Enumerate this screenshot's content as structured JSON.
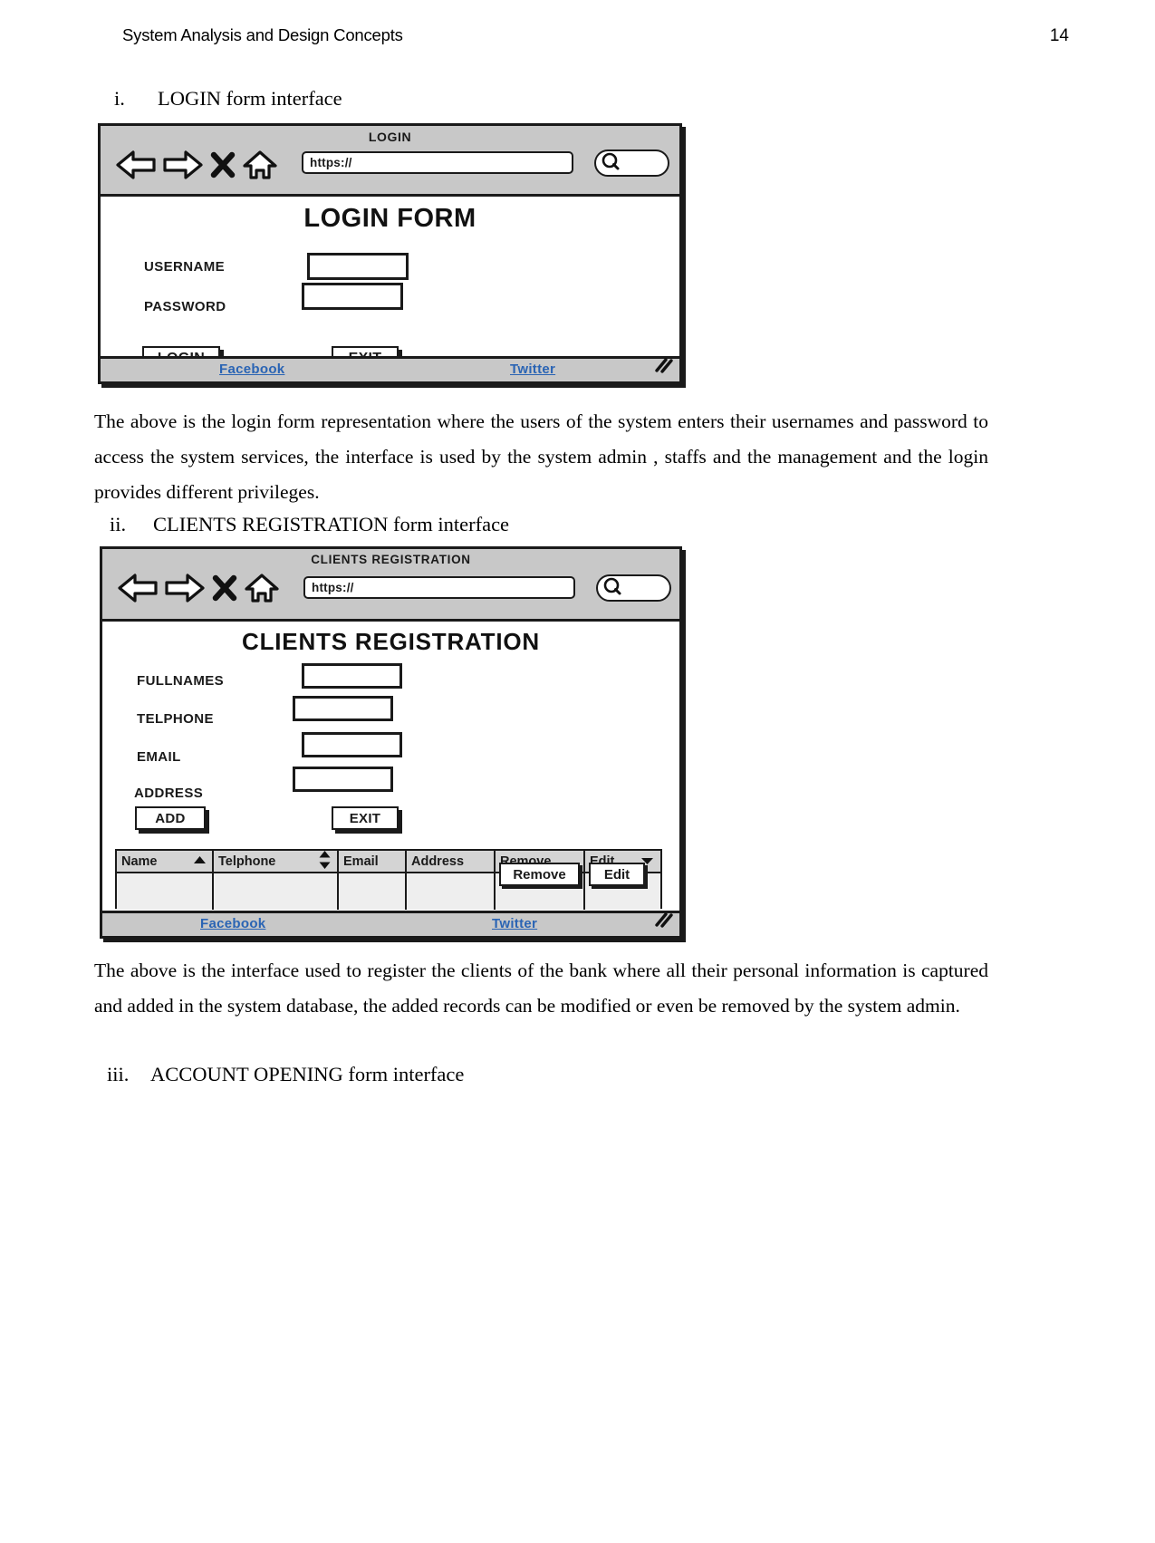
{
  "document": {
    "header_title": "System Analysis and Design Concepts",
    "page_number": "14"
  },
  "items": [
    {
      "marker": "i.",
      "text": "LOGIN form interface"
    },
    {
      "marker": "ii.",
      "text": "CLIENTS REGISTRATION form interface"
    },
    {
      "marker": "iii.",
      "text": "ACCOUNT OPENING form interface"
    }
  ],
  "paragraphs": {
    "login": "The above is the login form representation where the users of the system enters their usernames and password to access the system services, the interface is used by the system admin , staffs and the management and the login provides different privileges.",
    "clients": "The above is the interface used to register the clients of the bank where all their personal information is captured and added in the system database, the added records can be modified or even be removed by the system admin."
  },
  "login_mockup": {
    "browser": {
      "title": "LOGIN",
      "url_value": "https://",
      "back_icon": "back-arrow-icon",
      "forward_icon": "forward-arrow-icon",
      "close_icon": "close-x-icon",
      "home_icon": "home-icon",
      "search_icon": "search-icon"
    },
    "form_title": "LOGIN FORM",
    "fields": [
      {
        "label": "USERNAME",
        "value": ""
      },
      {
        "label": "PASSWORD",
        "value": ""
      }
    ],
    "buttons": [
      {
        "label": "LOGIN"
      },
      {
        "label": "EXIT"
      }
    ],
    "status": {
      "facebook": "Facebook",
      "twitter": "Twitter",
      "grip_icon": "resize-grip-icon"
    }
  },
  "clients_mockup": {
    "browser": {
      "title": "CLIENTS REGISTRATION",
      "url_value": "https://",
      "back_icon": "back-arrow-icon",
      "forward_icon": "forward-arrow-icon",
      "close_icon": "close-x-icon",
      "home_icon": "home-icon",
      "search_icon": "search-icon"
    },
    "form_title": "CLIENTS REGISTRATION",
    "fields": [
      {
        "label": "FULLNAMES",
        "value": ""
      },
      {
        "label": "TELPHONE",
        "value": ""
      },
      {
        "label": "EMAIL",
        "value": ""
      },
      {
        "label": "ADDRESS",
        "value": ""
      }
    ],
    "buttons": [
      {
        "label": "ADD"
      },
      {
        "label": "EXIT"
      }
    ],
    "table": {
      "columns": [
        {
          "label": "Name",
          "sort_icon": "sort-ascending-icon"
        },
        {
          "label": "Telphone",
          "sort_icon": "sort-updown-icon"
        },
        {
          "label": "Email",
          "sort_icon": ""
        },
        {
          "label": "Address",
          "sort_icon": ""
        },
        {
          "label": "Remove",
          "sort_icon": ""
        },
        {
          "label": "Edit",
          "sort_icon": "dropdown-caret-icon"
        }
      ],
      "rows": [
        {
          "name": "",
          "telphone": "",
          "email": "",
          "address": "",
          "remove_label": "Remove",
          "edit_label": "Edit"
        }
      ]
    },
    "status": {
      "facebook": "Facebook",
      "twitter": "Twitter",
      "grip_icon": "resize-grip-icon"
    }
  },
  "colors": {
    "chrome_gray": "#c8c8c8",
    "link_blue": "#2a64b4",
    "ink": "#1a1a1a",
    "table_header": "#d4d4d4",
    "table_row": "#eeeeee"
  }
}
